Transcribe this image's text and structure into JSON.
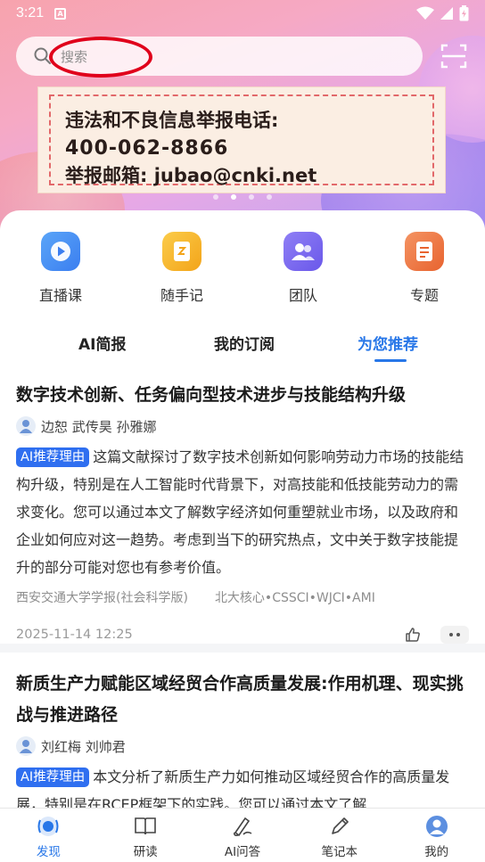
{
  "status_bar": {
    "time": "3:21",
    "notification_badge": "A",
    "icons": [
      "wifi-icon",
      "signal-icon",
      "battery-icon"
    ]
  },
  "search": {
    "placeholder": "搜索",
    "scan_icon": "scan-icon"
  },
  "banner": {
    "line1": "违法和不良信息举报电话:",
    "line2": "400-062-8866",
    "line3": "举报邮箱: jubao@cnki.net"
  },
  "carousel": {
    "count": 4,
    "active_index": 1
  },
  "quick_actions": [
    {
      "label": "直播课",
      "icon": "play-icon",
      "color": "#4a8ff2"
    },
    {
      "label": "随手记",
      "icon": "note-icon",
      "color": "#f6b62e"
    },
    {
      "label": "团队",
      "icon": "team-icon",
      "color": "#7c6cf0"
    },
    {
      "label": "专题",
      "icon": "topic-icon",
      "color": "#ee7a45"
    }
  ],
  "tabs": [
    {
      "label": "AI简报",
      "active": false
    },
    {
      "label": "我的订阅",
      "active": false
    },
    {
      "label": "为您推荐",
      "active": true
    }
  ],
  "articles": [
    {
      "title": "数字技术创新、任务偏向型技术进步与技能结构升级",
      "authors": "边恕 武传昊 孙雅娜",
      "tag": "AI推荐理由",
      "abstract": "这篇文献探讨了数字技术创新如何影响劳动力市场的技能结构升级，特别是在人工智能时代背景下，对高技能和低技能劳动力的需求变化。您可以通过本文了解数字经济如何重塑就业市场，以及政府和企业如何应对这一趋势。考虑到当下的研究热点，文中关于数字技能提升的部分可能对您也有参考价值。",
      "source": "西安交通大学学报(社会科学版)",
      "indexes": "北大核心•CSSCI•WJCI•AMI",
      "date": "2025-11-14 12:25"
    },
    {
      "title": "新质生产力赋能区域经贸合作高质量发展:作用机理、现实挑战与推进路径",
      "authors": "刘红梅 刘帅君",
      "tag": "AI推荐理由",
      "abstract": "本文分析了新质生产力如何推动区域经贸合作的高质量发展，特别是在RCEP框架下的实践。您可以通过本文了解"
    }
  ],
  "bottom_nav": [
    {
      "label": "发现",
      "icon": "discover-icon",
      "active": true
    },
    {
      "label": "研读",
      "icon": "book-icon",
      "active": false
    },
    {
      "label": "AI问答",
      "icon": "ai-pen-icon",
      "active": false
    },
    {
      "label": "笔记本",
      "icon": "pencil-icon",
      "active": false
    },
    {
      "label": "我的",
      "icon": "profile-icon",
      "active": false
    }
  ]
}
